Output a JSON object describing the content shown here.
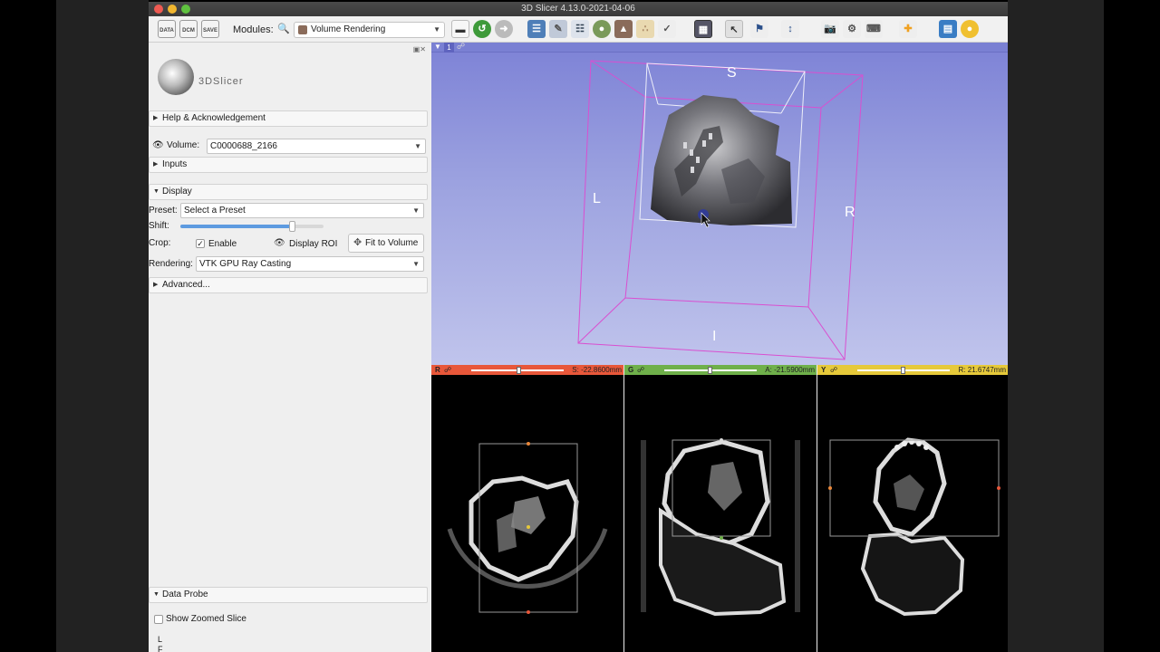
{
  "window": {
    "title": "3D Slicer 4.13.0-2021-04-06"
  },
  "toolbar": {
    "data_label": "DATA",
    "dcm_label": "DCM",
    "save_label": "SAVE",
    "modules_label": "Modules:",
    "module_selected": "Volume Rendering"
  },
  "logo": {
    "text": "3DSlicer"
  },
  "panel": {
    "help_section": "Help & Acknowledgement",
    "volume_label": "Volume:",
    "volume_value": "C0000688_2166",
    "inputs_section": "Inputs",
    "display_section": "Display",
    "preset_label": "Preset:",
    "preset_value": "Select a Preset",
    "shift_label": "Shift:",
    "shift_level": 0.78,
    "crop_label": "Crop:",
    "enable_label": "Enable",
    "display_roi_label": "Display ROI",
    "fit_to_volume_label": "Fit to Volume",
    "rendering_label": "Rendering:",
    "rendering_value": "VTK GPU Ray Casting",
    "advanced_section": "Advanced...",
    "data_probe_section": "Data Probe",
    "show_zoomed_slice_label": "Show Zoomed Slice",
    "probe_text_l": "L",
    "probe_text_f": "F"
  },
  "view3d": {
    "layout_number": "1",
    "orient_s": "S",
    "orient_l": "L",
    "orient_r": "R",
    "orient_i": "I"
  },
  "slice_views": {
    "red": {
      "tag": "R",
      "value": "S: -22.8600mm",
      "color": "#e8573a",
      "slider": 0.52
    },
    "green": {
      "tag": "G",
      "value": "A: -21.5900mm",
      "color": "#6fb04a",
      "slider": 0.5
    },
    "yellow": {
      "tag": "Y",
      "value": "R: 21.6747mm",
      "color": "#e6c93a",
      "slider": 0.5
    }
  },
  "colors": {
    "view_background_top": "#7d82d6",
    "roi_box": "#d94fd0",
    "accent_blue": "#5e9be0"
  }
}
